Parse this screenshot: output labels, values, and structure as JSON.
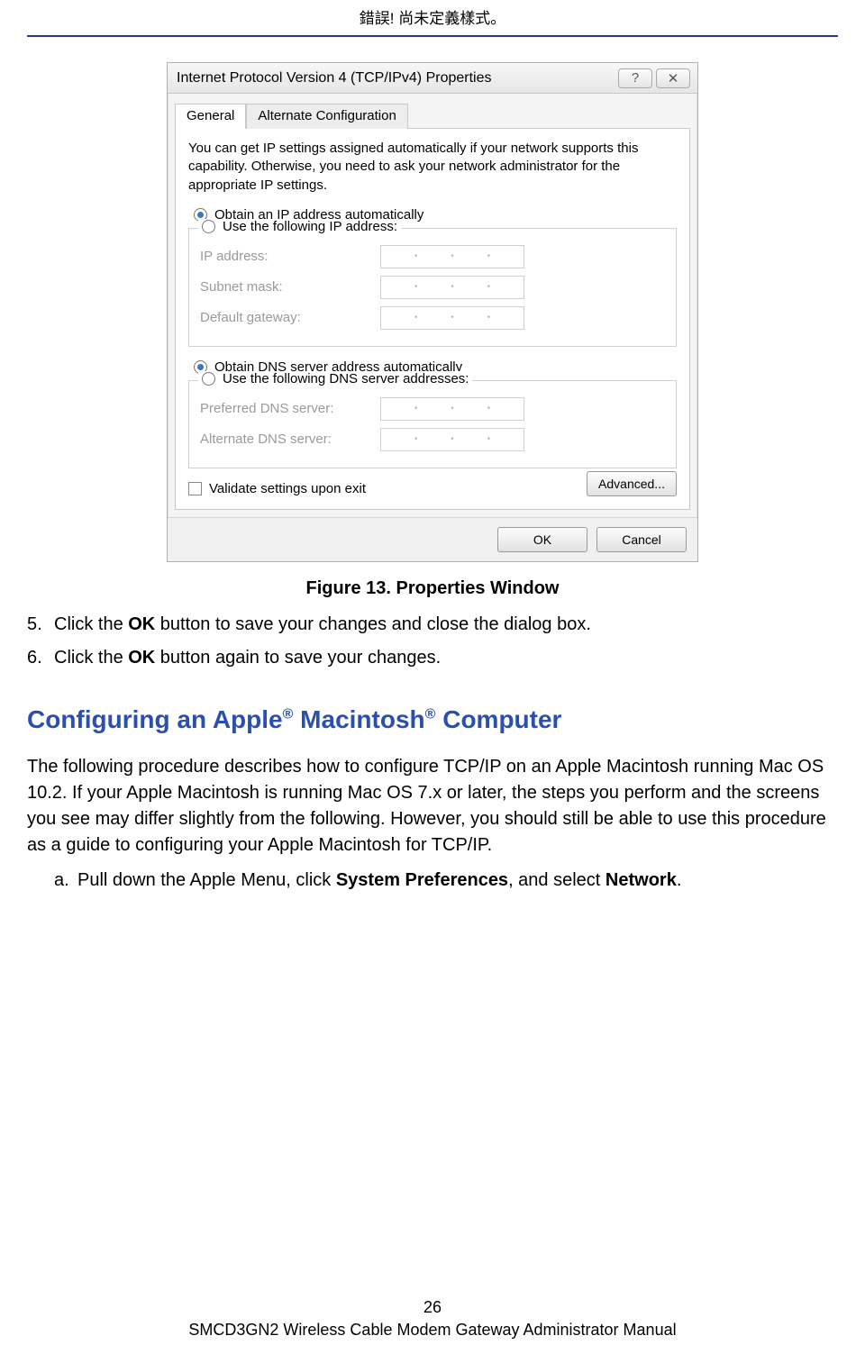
{
  "header": {
    "error_text": "錯誤! 尚未定義樣式。"
  },
  "dialog": {
    "title": "Internet Protocol Version 4 (TCP/IPv4) Properties",
    "help_icon": "?",
    "close_icon": "✕",
    "tabs": {
      "general": "General",
      "alt": "Alternate Configuration"
    },
    "intro": "You can get IP settings assigned automatically if your network supports this capability. Otherwise, you need to ask your network administrator for the appropriate IP settings.",
    "ip_auto": "Obtain an IP address automatically",
    "ip_manual": "Use the following IP address:",
    "fields_ip": {
      "ip": "IP address:",
      "subnet": "Subnet mask:",
      "gateway": "Default gateway:"
    },
    "dns_auto": "Obtain DNS server address automatically",
    "dns_manual": "Use the following DNS server addresses:",
    "fields_dns": {
      "preferred": "Preferred DNS server:",
      "alternate": "Alternate DNS server:"
    },
    "validate": "Validate settings upon exit",
    "advanced": "Advanced...",
    "ok": "OK",
    "cancel": "Cancel"
  },
  "caption": "Figure 13. Properties Window",
  "steps": {
    "n5": "5.",
    "s5a": "Click the ",
    "s5b": "OK",
    "s5c": " button to save your changes and close the dialog box.",
    "n6": "6.",
    "s6a": "Click the ",
    "s6b": "OK",
    "s6c": " button again to save your changes."
  },
  "section": {
    "title_a": "Configuring an Apple",
    "reg": "®",
    "title_b": " Macintosh",
    "title_c": " Computer",
    "para": "The following procedure describes how to configure TCP/IP on an Apple Macintosh running Mac OS 10.2. If your Apple Macintosh is running Mac OS 7.x or later, the steps you perform and the screens you see may differ slightly from the following. However, you should still be able to use this procedure as a guide to configuring your Apple Macintosh for TCP/IP.",
    "sub_letter": "a.",
    "sub_a1": "Pull down the Apple Menu, click ",
    "sub_a2": "System Preferences",
    "sub_a3": ", and select ",
    "sub_a4": "Network",
    "sub_a5": "."
  },
  "footer": {
    "page": "26",
    "manual": "SMCD3GN2 Wireless Cable Modem Gateway Administrator Manual"
  }
}
